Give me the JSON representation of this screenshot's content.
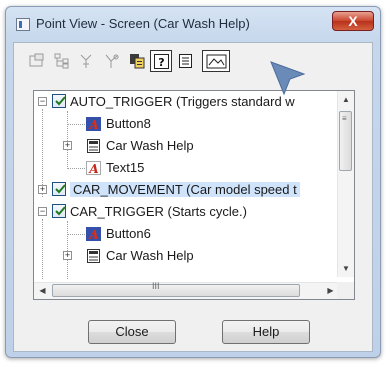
{
  "window": {
    "title": "Point View - Screen (Car Wash Help)",
    "close_glyph": "X"
  },
  "toolbar": {
    "buttons": [
      {
        "icon": "properties-icon"
      },
      {
        "icon": "tree-structure-icon"
      },
      {
        "icon": "tree-expand-icon"
      },
      {
        "icon": "tree-collapse-icon"
      },
      {
        "icon": "copy-icon"
      },
      {
        "icon": "help-icon",
        "glyph": "?"
      },
      {
        "icon": "list-view-icon"
      },
      {
        "icon": "screen-view-icon"
      }
    ]
  },
  "tree": {
    "rows": [
      {
        "label": "AUTO_TRIGGER (Triggers standard w",
        "type": "point",
        "expander": "−",
        "checked": true
      },
      {
        "label": "Button8",
        "type": "button-object"
      },
      {
        "label": "Car Wash Help",
        "type": "screen",
        "expander": "+"
      },
      {
        "label": "Text15",
        "type": "text-object"
      },
      {
        "label": "CAR_MOVEMENT (Car model speed t",
        "type": "point",
        "expander": "+",
        "checked": true,
        "selected": true
      },
      {
        "label": "CAR_TRIGGER (Starts cycle.)",
        "type": "point",
        "expander": "−",
        "checked": true
      },
      {
        "label": "Button6",
        "type": "button-object"
      },
      {
        "label": "Car Wash Help",
        "type": "screen",
        "expander": "+"
      }
    ],
    "hscroll_grip": "III",
    "vscroll_grip": "≡"
  },
  "buttons": {
    "close": "Close",
    "help": "Help"
  },
  "colors": {
    "accent": "#3a6fc0",
    "selection": "#cfe3fb",
    "close_red": "#c9452e"
  }
}
